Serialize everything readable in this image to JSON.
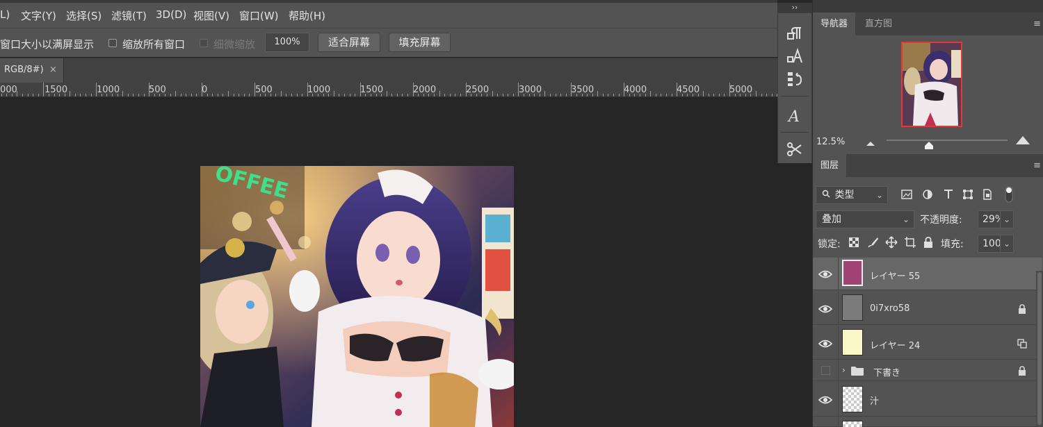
{
  "menu": {
    "items": [
      "L)",
      "文字(Y)",
      "选择(S)",
      "滤镜(T)",
      "3D(D)",
      "视图(V)",
      "窗口(W)",
      "帮助(H)"
    ]
  },
  "options": {
    "resize_windows_label": "窗口大小以满屏显示",
    "zoom_all_label": "缩放所有窗口",
    "scrubby_zoom_label": "细微缩放",
    "zoom_field": "100%",
    "fit_screen_button": "适合屏幕",
    "fill_screen_button": "填充屏幕"
  },
  "document_tab": {
    "title": "RGB/8#)",
    "close_glyph": "×"
  },
  "ruler": {
    "labels": [
      "000",
      "1500",
      "1000",
      "500",
      "0",
      "500",
      "1000",
      "1500",
      "2000",
      "2500",
      "3000",
      "3500",
      "4000",
      "4500",
      "5000"
    ]
  },
  "icon_column": {
    "collapse_glyph": "››",
    "icons": [
      "paragraph-icon",
      "character-style-icon",
      "history-icon",
      "glyphs-icon",
      "tools-preset-icon"
    ]
  },
  "navigator": {
    "tabs": [
      "导航器",
      "直方图"
    ],
    "menu_glyph": "≡",
    "zoom_value": "12.5%",
    "zoom_fraction": 0.35
  },
  "layers_panel": {
    "tab_label": "图层",
    "menu_glyph": "≡",
    "filter_type": "类型",
    "blend_mode": "叠加",
    "opacity_label": "不透明度:",
    "opacity_value": "29%",
    "lock_label": "锁定:",
    "fill_label": "填充:",
    "fill_value": "100%",
    "layers": [
      {
        "name": "レイヤー 55",
        "visible": true,
        "selected": true,
        "thumb_color": "#a24473",
        "right_icon": ""
      },
      {
        "name": "0i7xro58",
        "visible": true,
        "selected": false,
        "thumb_color": "#7b7b7b",
        "right_icon": "lock-icon"
      },
      {
        "name": "レイヤー 24",
        "visible": true,
        "selected": false,
        "thumb_color": "#fbf7c8",
        "right_icon": "smart-object-icon"
      },
      {
        "name": "下書き",
        "visible": false,
        "selected": false,
        "group": true,
        "right_icon": "lock-icon"
      },
      {
        "name": "汁",
        "visible": true,
        "selected": false,
        "thumb_color": "checker",
        "right_icon": ""
      }
    ]
  },
  "colors": {
    "accent_navigator_frame": "#e23a3a",
    "panel_bg": "#535353",
    "canvas_bg": "#262626"
  }
}
